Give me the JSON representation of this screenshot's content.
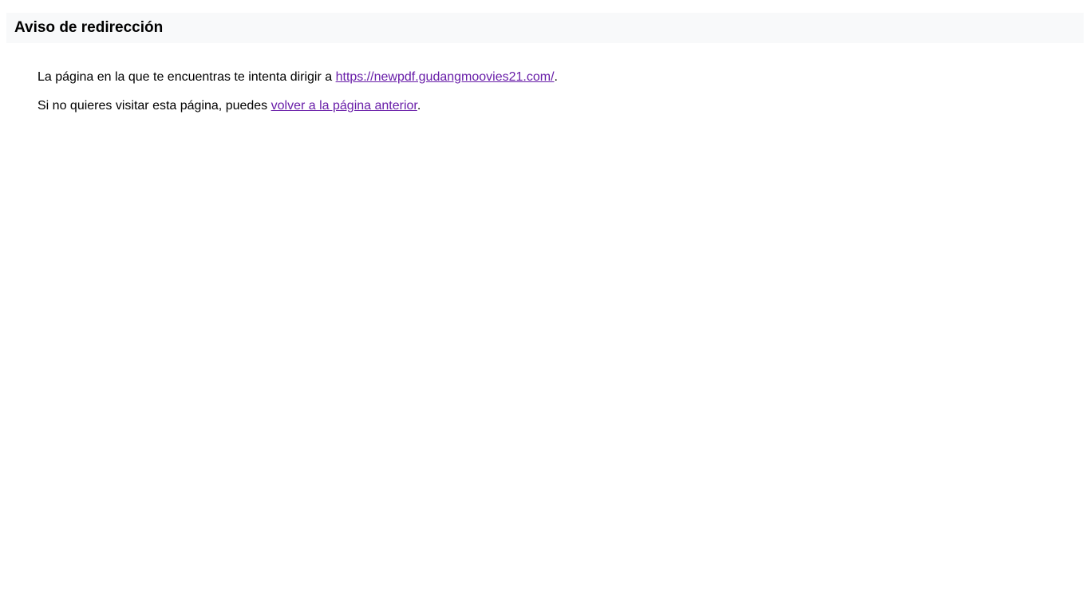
{
  "header": {
    "title": "Aviso de redirección"
  },
  "main": {
    "line1": {
      "prefix": "La página en la que te encuentras te intenta dirigir a ",
      "link_text": "https://newpdf.gudangmoovies21.com/",
      "suffix": "."
    },
    "line2": {
      "prefix": "Si no quieres visitar esta página, puedes ",
      "link_text": "volver a la página anterior",
      "suffix": "."
    }
  },
  "colors": {
    "header_bg": "#f8f9fa",
    "link": "#681da8",
    "text": "#000000"
  }
}
